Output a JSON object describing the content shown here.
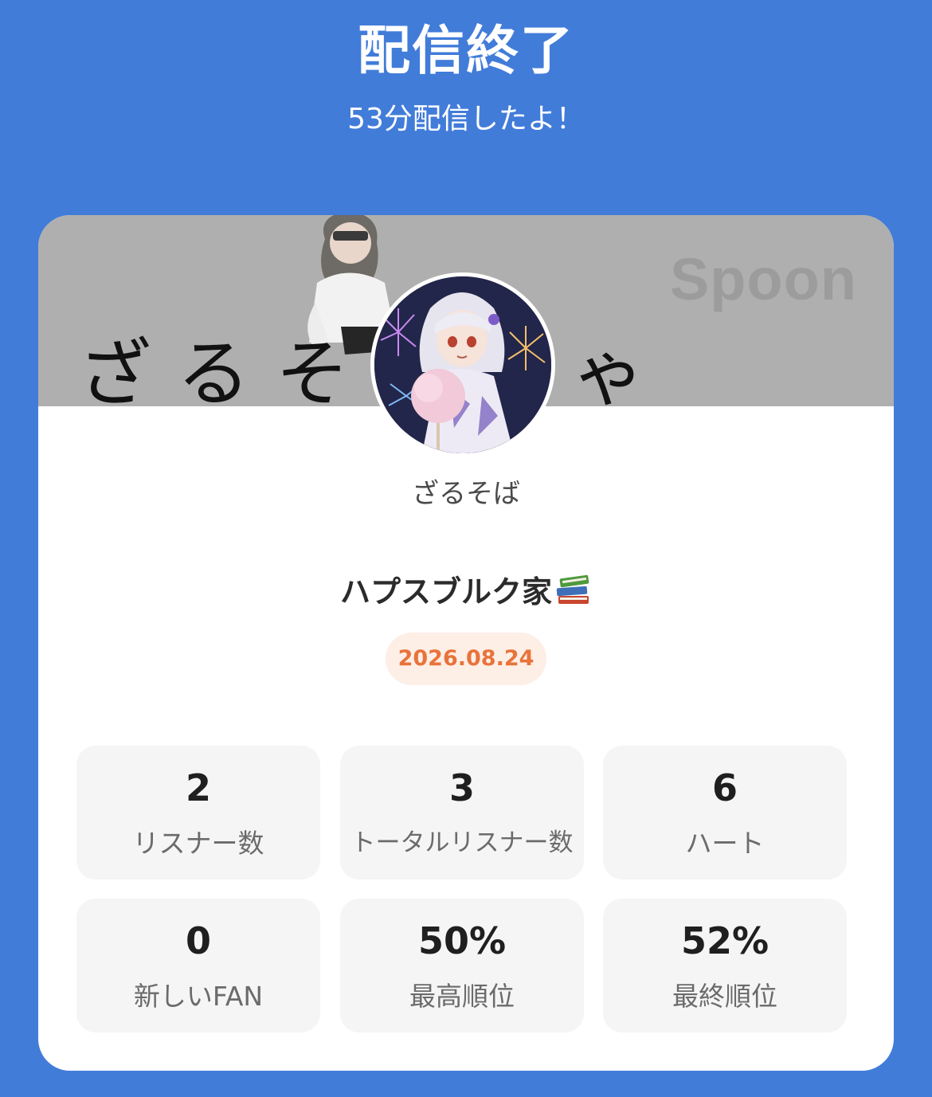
{
  "header": {
    "title": "配信終了",
    "subtitle": "53分配信したよ！"
  },
  "banner": {
    "text": "ざるそばちゃ",
    "logo": "Spoon"
  },
  "profile": {
    "name": "ざるそば"
  },
  "live": {
    "title": "ハプスブルク家",
    "emoji": "books-icon",
    "date": "2026.08.24"
  },
  "stats": [
    {
      "value": "2",
      "label": "リスナー数"
    },
    {
      "value": "3",
      "label": "トータルリスナー数"
    },
    {
      "value": "6",
      "label": "ハート"
    },
    {
      "value": "0",
      "label": "新しいFAN"
    },
    {
      "value": "50%",
      "label": "最高順位"
    },
    {
      "value": "52%",
      "label": "最終順位"
    }
  ],
  "colors": {
    "background": "#427CD9",
    "banner": "#AFAFAF",
    "date_badge_bg": "#FDEEE6",
    "date_badge_text": "#E8733A",
    "stat_bg": "#F5F5F5"
  }
}
